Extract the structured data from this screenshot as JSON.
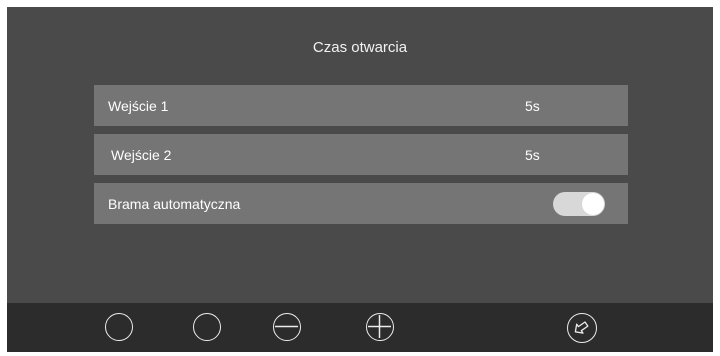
{
  "header": {
    "title": "Czas otwarcia"
  },
  "settings": {
    "rows": [
      {
        "label": "Wejście 1",
        "value": "5s"
      },
      {
        "label": "Wejście 2",
        "value": "5s"
      },
      {
        "label": "Brama automatyczna",
        "toggle_on": true
      }
    ]
  },
  "toolbar": {
    "buttons": [
      {
        "icon": "circle-icon"
      },
      {
        "icon": "circle-icon"
      },
      {
        "icon": "minus-icon"
      },
      {
        "icon": "plus-icon"
      },
      {
        "icon": "back-arrow-icon"
      }
    ]
  },
  "colors": {
    "background": "#4a4a4a",
    "row": "#757575",
    "toolbar": "#2c2c2c",
    "toggle_track": "#d8d8d8"
  }
}
